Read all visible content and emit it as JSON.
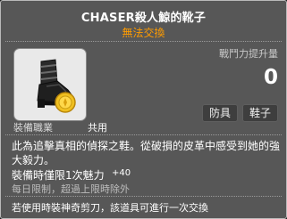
{
  "tooltip": {
    "item_name": "CHASER殺人鯨的靴子",
    "trade_status": "無法交換",
    "power_label": "戰鬥力提升量",
    "power_value": "0",
    "tags": [
      "防具",
      "鞋子"
    ],
    "job_label": "裝備職業",
    "job_value": "共用",
    "description": "此為追擊真相的偵探之鞋。從破損的皮革中感受到她的強大毅力。",
    "charm_text": "裝備時僅限1次魅力",
    "charm_value": "+40",
    "limit_text": "每日限制，超過上限時除外",
    "scissors_text": "若使用時裝神奇剪刀，該道具可進行一次交換",
    "item_icon": "black-boot-with-gold-coin-icon",
    "colors": {
      "background": "#575757",
      "border": "#b9b9b9",
      "trade_status": "#ff9c00",
      "text": "#ffffff"
    }
  }
}
